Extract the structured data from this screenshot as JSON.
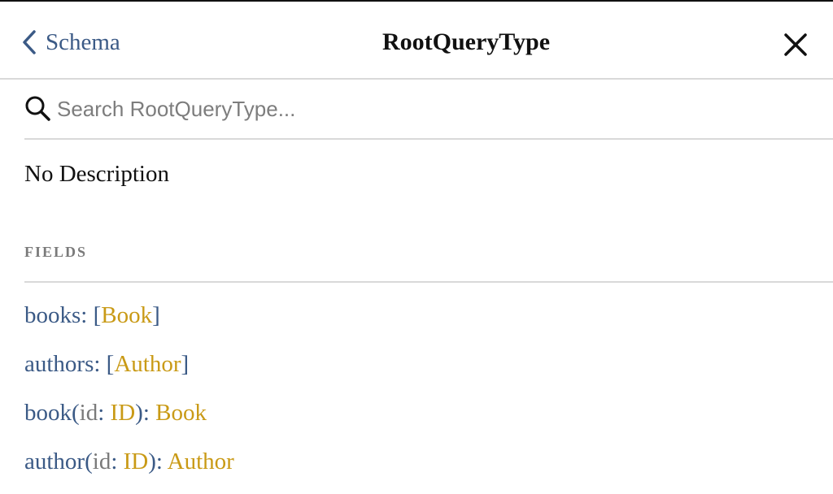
{
  "header": {
    "back_label": "Schema",
    "title": "RootQueryType",
    "back_icon": "chevron-left-icon",
    "close_icon": "close-icon"
  },
  "search": {
    "placeholder": "Search RootQueryType...",
    "value": "",
    "icon": "search-icon"
  },
  "description": "No Description",
  "fields_heading": "FIELDS",
  "fields": [
    {
      "name": "books",
      "type": "Book",
      "list": true
    },
    {
      "name": "authors",
      "type": "Author",
      "list": true
    },
    {
      "name": "book",
      "arg_name": "id",
      "arg_type": "ID",
      "type": "Book",
      "list": false
    },
    {
      "name": "author",
      "arg_name": "id",
      "arg_type": "ID",
      "type": "Author",
      "list": false
    }
  ],
  "colors": {
    "field_name": "#3b5a86",
    "type_name": "#c99a16",
    "arg_name": "#7a7a7a",
    "muted_heading": "#7a7a7a",
    "divider": "#d9d9d9"
  }
}
